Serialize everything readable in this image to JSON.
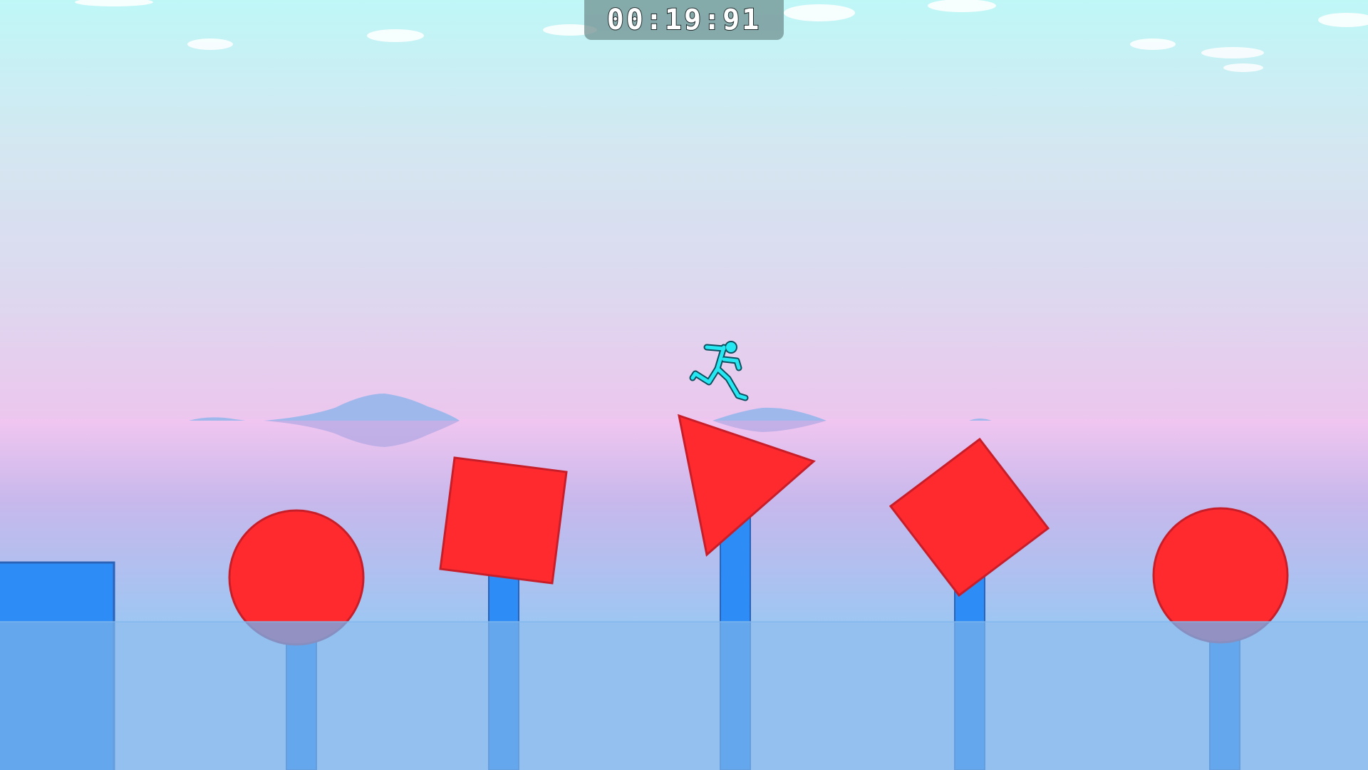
{
  "hud": {
    "timer": "00:19:91"
  },
  "colors": {
    "sky_top": "#bff7f7",
    "sky_mid": "#dde0ef",
    "sky_horizon": "#ecc6ee",
    "below_horizon": "#c5b6ec",
    "water": "#74aeea",
    "platform_blue": "#2e8cf6",
    "obstacle_red": "#ff2a2e",
    "obstacle_red_stroke": "#c81e2a",
    "stickman": "#26e8f2",
    "stickman_outline": "#0c4e5e",
    "distant_islands": "#9eb8ec"
  },
  "scene": {
    "player": "cyan-stickman-runner",
    "obstacles": [
      "circle",
      "square",
      "triangle",
      "diamond",
      "circle"
    ]
  }
}
